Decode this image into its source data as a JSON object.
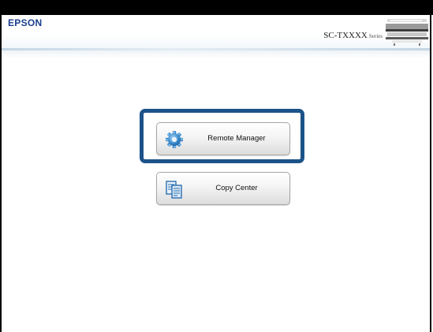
{
  "header": {
    "logo_text": "EPSON",
    "model_text": "SC-TXXXX",
    "model_series": "Series",
    "printer_icon": "printer-icon",
    "brand_color": "#1a3f8f"
  },
  "menu": {
    "remote_manager": {
      "label": "Remote Manager",
      "icon": "gear-icon",
      "highlighted": true,
      "highlight_color": "#1b5389"
    },
    "copy_center": {
      "label": "Copy Center",
      "icon": "copy-documents-icon"
    }
  }
}
